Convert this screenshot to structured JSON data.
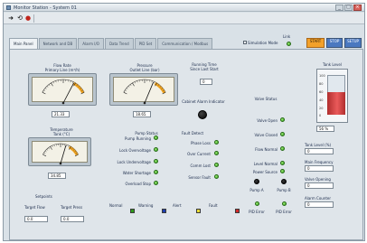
{
  "window": {
    "title": "Monitor Station ‐ System 01"
  },
  "toolbar": {
    "run_glyph": "➜",
    "loop_glyph": "⟲",
    "stop_glyph": "●"
  },
  "tabs": [
    {
      "label": "Main Panel"
    },
    {
      "label": "Network and DB"
    },
    {
      "label": "Alarm I/O"
    },
    {
      "label": "Data Trend"
    },
    {
      "label": "PID Set"
    },
    {
      "label": "Communication / Modbus"
    }
  ],
  "top_controls": {
    "toggle_label": "Simulation Mode",
    "led_label": "Link",
    "btn_orange": "START",
    "btn_blue_1": "STOP",
    "btn_blue_2": "SETUP"
  },
  "meters": [
    {
      "title": "Flow Rate",
      "subtitle": "Primary Line (m³/h)",
      "readout": "21.33",
      "value": 0.72
    },
    {
      "title": "Pressure",
      "subtitle": "Outlet Line (bar)",
      "readout": "18.65",
      "value": 0.68
    },
    {
      "title": "Temperature",
      "subtitle": "Tank (°C)",
      "readout": "34.85",
      "value": 0.63
    }
  ],
  "center": {
    "title": "Running Time",
    "subtitle": "Since Last Start",
    "box_value": "0",
    "indicator_label": "Cabinet Alarm Indicator"
  },
  "led_col1": {
    "header": "Pump Status",
    "items": [
      "Pump Running",
      "Lock Overvoltage",
      "Lock Undervoltage",
      "Water Shortage",
      "Overload Stop"
    ]
  },
  "led_col2": {
    "header": "Fault Detect",
    "items": [
      "Phase Loss",
      "Over Current",
      "Comm Lost",
      "Sensor Fault"
    ]
  },
  "led_col3": {
    "header": "Valve Status",
    "items": [
      "Valve Open",
      "Valve Closed",
      "Flow Normal",
      "Level Normal",
      "Power Source"
    ]
  },
  "bottom_left": {
    "title": "Setpoints",
    "field1_label": "Target Flow",
    "field1_value": "0.0",
    "field2_label": "Target Press",
    "field2_value": "0.0"
  },
  "legend": [
    {
      "label": "Normal",
      "color": "#2f9b1c"
    },
    {
      "label": "Warning",
      "color": "#1e3fae"
    },
    {
      "label": "Alert",
      "color": "#e8dc38"
    },
    {
      "label": "Fault",
      "color": "#d22a2a"
    }
  ],
  "pump_indicators": {
    "a_label": "Pump A",
    "a_foot": "PID Error",
    "b_label": "Pump B",
    "b_foot": "PID Error"
  },
  "right_fields": {
    "f1_label": "Tank Level (%)",
    "f1_value": "0",
    "f2_label": "Main Frequency",
    "f2_value": "0",
    "f3_label": "Valve Opening",
    "f3_value": "0",
    "f4_label": "Alarm Counter",
    "f4_value": "0"
  },
  "tank": {
    "label": "Tank Level",
    "readout": "56 %",
    "level": 0.56,
    "scale": [
      "100",
      "80",
      "60",
      "40",
      "20",
      "0"
    ]
  }
}
